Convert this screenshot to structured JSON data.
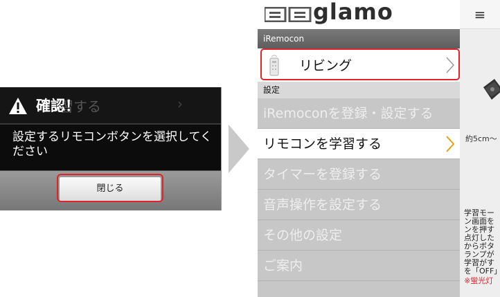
{
  "dialog": {
    "title": "確認！",
    "background_text": "習する",
    "message": "設定するリモコンボタンを選択してください",
    "close_button": "閉じる",
    "icon": "warning-icon"
  },
  "app": {
    "logo_text": "glamo",
    "section_device": "iRemocon",
    "device_label": "リビング",
    "section_settings": "設定",
    "menu": [
      {
        "label": "iRemoconを登録・設定する"
      },
      {
        "label": "リモコンを学習する"
      },
      {
        "label": "タイマーを登録する"
      },
      {
        "label": "音声操作を設定する"
      },
      {
        "label": "その他の設定"
      },
      {
        "label": "ご案内"
      }
    ],
    "active_menu_index": 1
  },
  "side_panel": {
    "size_text": "約5cm〜",
    "lines": [
      "学習モー",
      "ン画面を",
      "ンを押す",
      "点灯した",
      "からボタ",
      "ランプが",
      "学習がす",
      "を「OFF」"
    ],
    "note": "※蛍光灯"
  },
  "colors": {
    "highlight": "#e0242b",
    "menu_inactive": "#c7c7c7",
    "header_gray": "#6b6b6b"
  }
}
